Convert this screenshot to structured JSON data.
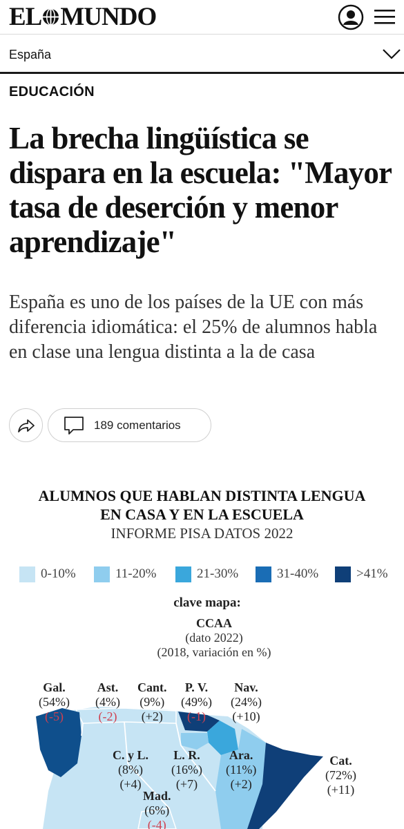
{
  "header": {
    "logo_left": "EL",
    "logo_right": "MUNDO",
    "section": "España"
  },
  "article": {
    "kicker": "EDUCACIÓN",
    "headline": "La brecha lingüística se dispara en la escuela: \"Mayor tasa de deserción y menor aprendizaje\"",
    "standfirst": "España es uno de los países de la UE con más diferencia idiomática: el 25% de alumnos habla en clase una lengua distinta a la de casa",
    "comments_label": "189 comentarios"
  },
  "infographic": {
    "title_line1": "ALUMNOS QUE HABLAN DISTINTA LENGUA",
    "title_line2": "EN CASA Y EN LA ESCUELA",
    "subtitle": "INFORME PISA DATOS 2022",
    "legend": [
      {
        "label": "0-10%",
        "color": "#c6e4f4"
      },
      {
        "label": "11-20%",
        "color": "#8fcdee"
      },
      {
        "label": "21-30%",
        "color": "#3aa7dc"
      },
      {
        "label": "31-40%",
        "color": "#1a6db5"
      },
      {
        "label": ">41%",
        "color": "#0f3f78"
      }
    ],
    "key": {
      "title": "clave mapa:",
      "region": "CCAA",
      "line1": "(dato 2022)",
      "line2": "(2018, variación en %)"
    },
    "regions": [
      {
        "name": "Gal.",
        "value": "(54%)",
        "change": "(-5)",
        "negative": true
      },
      {
        "name": "Ast.",
        "value": "(4%)",
        "change": "(-2)",
        "negative": true
      },
      {
        "name": "Cant.",
        "value": "(9%)",
        "change": "(+2)",
        "negative": false
      },
      {
        "name": "P. V.",
        "value": "(49%)",
        "change": "(-1)",
        "negative": true
      },
      {
        "name": "Nav.",
        "value": "(24%)",
        "change": "(+10)",
        "negative": false
      },
      {
        "name": "C. y L.",
        "value": "(8%)",
        "change": "(+4)",
        "negative": false
      },
      {
        "name": "L. R.",
        "value": "(16%)",
        "change": "(+7)",
        "negative": false
      },
      {
        "name": "Ara.",
        "value": "(11%)",
        "change": "(+2)",
        "negative": false
      },
      {
        "name": "Cat.",
        "value": "(72%)",
        "change": "(+11)",
        "negative": false
      },
      {
        "name": "Mad.",
        "value": "(6%)",
        "change": "(-4)",
        "negative": true
      }
    ]
  }
}
